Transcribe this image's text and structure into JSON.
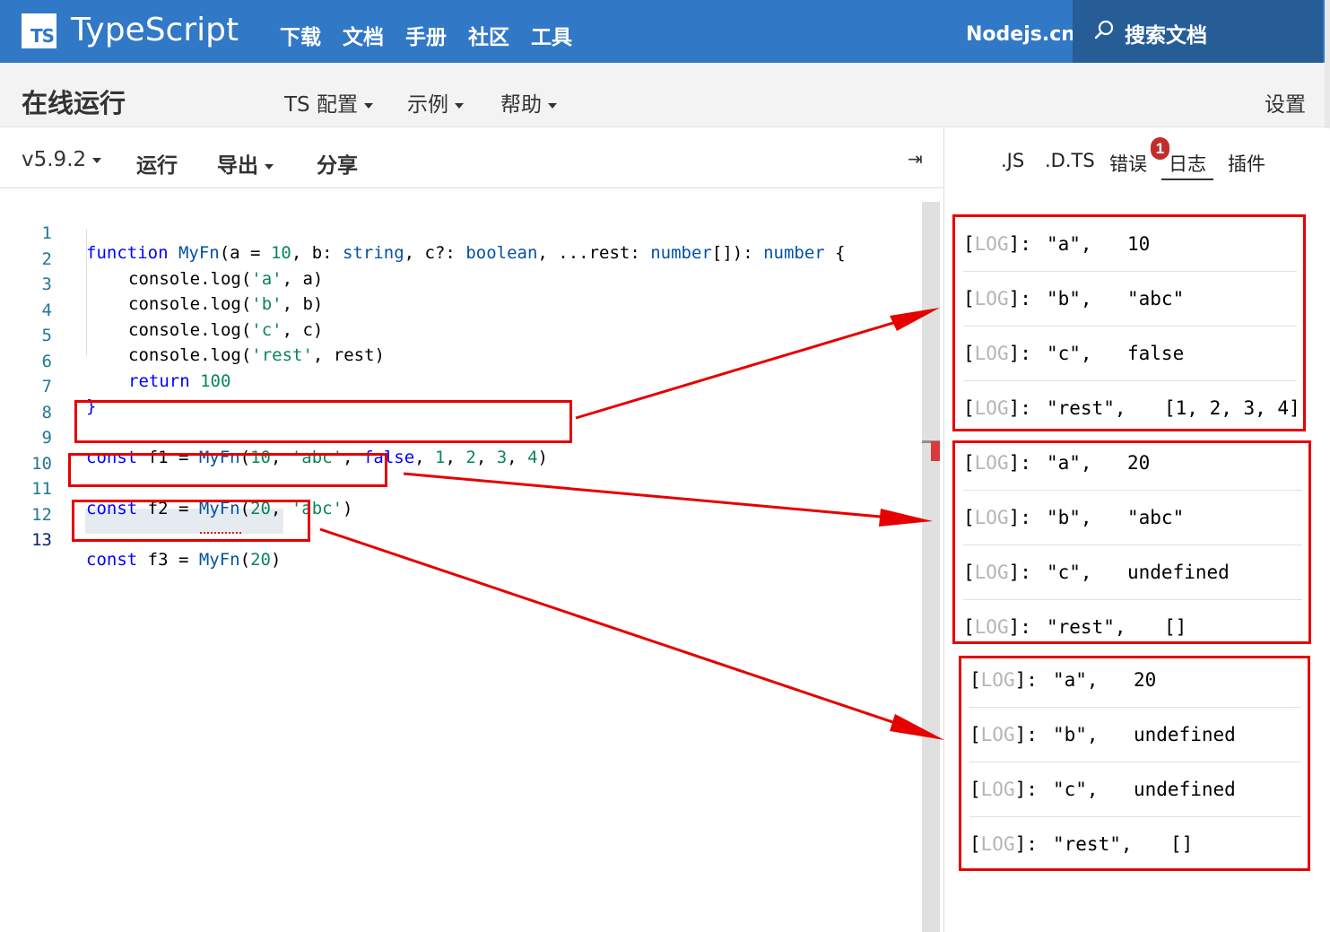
{
  "topnav": {
    "logo_text": "TS",
    "brand": "TypeScript",
    "links": [
      "下载",
      "文档",
      "手册",
      "社区",
      "工具"
    ],
    "nodejs": "Nodejs.cn",
    "search_label": "搜索文档",
    "bg_color": "#3178c6"
  },
  "subbar": {
    "title": "在线运行",
    "menus": [
      "TS 配置",
      "示例",
      "帮助"
    ],
    "settings": "设置"
  },
  "toolbar": {
    "version": "v5.9.2",
    "run": "运行",
    "export": "导出",
    "share": "分享",
    "collapse_icon": "⇥"
  },
  "right_tabs": {
    "js": ".JS",
    "dts": ".D.TS",
    "errors": "错误",
    "error_count": "1",
    "logs": "日志",
    "plugins": "插件"
  },
  "code": {
    "line_numbers": [
      "1",
      "2",
      "3",
      "4",
      "5",
      "6",
      "7",
      "8",
      "9",
      "10",
      "11",
      "12",
      "13"
    ],
    "lines": [
      "function MyFn(a = 10, b: string, c?: boolean, ...rest: number[]): number {",
      "console.log('a', a)",
      "console.log('b', b)",
      "console.log('c', c)",
      "console.log('rest', rest)",
      "return 100",
      "}",
      "",
      "const f1 = MyFn(10, 'abc', false, 1, 2, 3, 4)",
      "",
      "const f2 = MyFn(20, 'abc')",
      "",
      "const f3 = MyFn(20)"
    ]
  },
  "logs": {
    "tag": "LOG",
    "groups": [
      [
        {
          "key": "\"a\",",
          "value": "10"
        },
        {
          "key": "\"b\",",
          "value": "\"abc\""
        },
        {
          "key": "\"c\",",
          "value": "false"
        },
        {
          "key": "\"rest\",",
          "value": "[1, 2, 3, 4]"
        }
      ],
      [
        {
          "key": "\"a\",",
          "value": "20"
        },
        {
          "key": "\"b\",",
          "value": "\"abc\""
        },
        {
          "key": "\"c\",",
          "value": "undefined"
        },
        {
          "key": "\"rest\",",
          "value": "[]"
        }
      ],
      [
        {
          "key": "\"a\",",
          "value": "20"
        },
        {
          "key": "\"b\",",
          "value": "undefined"
        },
        {
          "key": "\"c\",",
          "value": "undefined"
        },
        {
          "key": "\"rest\",",
          "value": "[]"
        }
      ]
    ]
  },
  "annotation_color": "#e60000"
}
